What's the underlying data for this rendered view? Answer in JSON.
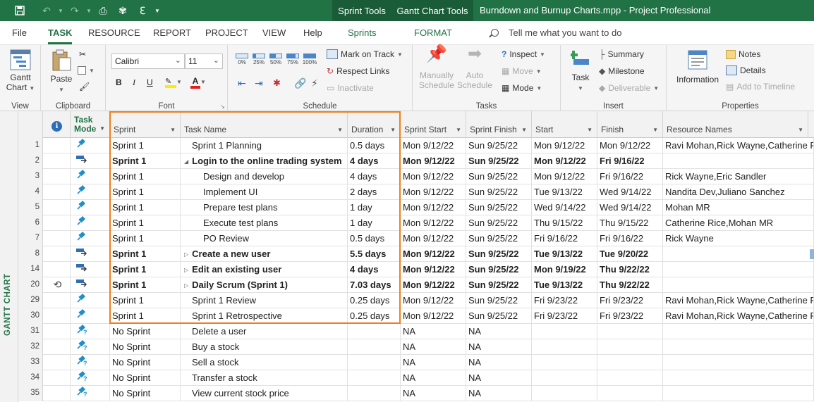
{
  "title_bar": {
    "context_tabs": [
      "Sprint Tools",
      "Gantt Chart Tools"
    ],
    "document_title": "Burndown and Burnup Charts.mpp  -  Project Professional"
  },
  "ribbon_tabs": [
    "File",
    "TASK",
    "RESOURCE",
    "REPORT",
    "PROJECT",
    "VIEW",
    "Help",
    "Sprints",
    "FORMAT"
  ],
  "tell_me": "Tell me what you want to do",
  "ribbon": {
    "view": {
      "gantt_chart": "Gantt\nChart",
      "label": "View"
    },
    "clipboard": {
      "paste": "Paste",
      "label": "Clipboard"
    },
    "font": {
      "family": "Calibri",
      "size": "11",
      "bold": "B",
      "italic": "I",
      "underline": "U",
      "label": "Font"
    },
    "schedule": {
      "mark_on_track": "Mark on Track",
      "respect_links": "Respect Links",
      "inactivate": "Inactivate",
      "label": "Schedule",
      "percents": [
        "0%",
        "25%",
        "50%",
        "75%",
        "100%"
      ]
    },
    "tasks": {
      "manually_schedule": "Manually\nSchedule",
      "auto_schedule": "Auto\nSchedule",
      "inspect": "Inspect",
      "move": "Move",
      "mode": "Mode",
      "label": "Tasks"
    },
    "insert": {
      "task": "Task",
      "summary": "Summary",
      "milestone": "Milestone",
      "deliverable": "Deliverable",
      "label": "Insert"
    },
    "properties": {
      "information": "Information",
      "notes": "Notes",
      "details": "Details",
      "add_to_timeline": "Add to Timeline",
      "label": "Properties"
    }
  },
  "view_label": "GANTT CHART",
  "columns": [
    "Task\nMode",
    "Sprint",
    "Task Name",
    "Duration",
    "Sprint Start",
    "Sprint Finish",
    "Start",
    "Finish",
    "Resource Names"
  ],
  "rows": [
    {
      "id": "1",
      "sprint": "Sprint 1",
      "name": "Sprint 1 Planning",
      "indent": 0,
      "summary": false,
      "dur": "0.5 days",
      "ss": "Mon 9/12/22",
      "sf": "Sun 9/25/22",
      "start": "Mon 9/12/22",
      "finish": "Mon 9/12/22",
      "res": "Ravi Mohan,Rick Wayne,Catherine Rice",
      "mode": "pin"
    },
    {
      "id": "2",
      "sprint": "Sprint 1",
      "name": "Login to the online trading system",
      "indent": 0,
      "summary": true,
      "expanded": true,
      "dur": "4 days",
      "ss": "Mon 9/12/22",
      "sf": "Sun 9/25/22",
      "start": "Mon 9/12/22",
      "finish": "Fri 9/16/22",
      "res": "",
      "mode": "auto"
    },
    {
      "id": "3",
      "sprint": "Sprint 1",
      "name": "Design and develop",
      "indent": 1,
      "summary": false,
      "dur": "4 days",
      "ss": "Mon 9/12/22",
      "sf": "Sun 9/25/22",
      "start": "Mon 9/12/22",
      "finish": "Fri 9/16/22",
      "res": "Rick Wayne,Eric Sandler",
      "mode": "pin"
    },
    {
      "id": "4",
      "sprint": "Sprint 1",
      "name": "Implement UI",
      "indent": 1,
      "summary": false,
      "dur": "2 days",
      "ss": "Mon 9/12/22",
      "sf": "Sun 9/25/22",
      "start": "Tue 9/13/22",
      "finish": "Wed 9/14/22",
      "res": "Nandita Dev,Juliano Sanchez",
      "mode": "pin"
    },
    {
      "id": "5",
      "sprint": "Sprint 1",
      "name": "Prepare test plans",
      "indent": 1,
      "summary": false,
      "dur": "1 day",
      "ss": "Mon 9/12/22",
      "sf": "Sun 9/25/22",
      "start": "Wed 9/14/22",
      "finish": "Wed 9/14/22",
      "res": "Mohan MR",
      "mode": "pin"
    },
    {
      "id": "6",
      "sprint": "Sprint 1",
      "name": "Execute test plans",
      "indent": 1,
      "summary": false,
      "dur": "1 day",
      "ss": "Mon 9/12/22",
      "sf": "Sun 9/25/22",
      "start": "Thu 9/15/22",
      "finish": "Thu 9/15/22",
      "res": "Catherine Rice,Mohan MR",
      "mode": "pin"
    },
    {
      "id": "7",
      "sprint": "Sprint 1",
      "name": "PO Review",
      "indent": 1,
      "summary": false,
      "dur": "0.5 days",
      "ss": "Mon 9/12/22",
      "sf": "Sun 9/25/22",
      "start": "Fri 9/16/22",
      "finish": "Fri 9/16/22",
      "res": "Rick Wayne",
      "mode": "pin"
    },
    {
      "id": "8",
      "sprint": "Sprint 1",
      "name": "Create a new user",
      "indent": 0,
      "summary": true,
      "expanded": false,
      "dur": "5.5 days",
      "ss": "Mon 9/12/22",
      "sf": "Sun 9/25/22",
      "start": "Tue 9/13/22",
      "finish": "Tue 9/20/22",
      "res": "",
      "mode": "auto"
    },
    {
      "id": "14",
      "sprint": "Sprint 1",
      "name": "Edit an existing user",
      "indent": 0,
      "summary": true,
      "expanded": false,
      "dur": "4 days",
      "ss": "Mon 9/12/22",
      "sf": "Sun 9/25/22",
      "start": "Mon 9/19/22",
      "finish": "Thu 9/22/22",
      "res": "",
      "mode": "auto"
    },
    {
      "id": "20",
      "sprint": "Sprint 1",
      "name": "Daily Scrum (Sprint 1)",
      "indent": 0,
      "summary": true,
      "expanded": false,
      "recurring": true,
      "dur": "7.03 days",
      "ss": "Mon 9/12/22",
      "sf": "Sun 9/25/22",
      "start": "Tue 9/13/22",
      "finish": "Thu 9/22/22",
      "res": "",
      "mode": "auto"
    },
    {
      "id": "29",
      "sprint": "Sprint 1",
      "name": "Sprint 1 Review",
      "indent": 0,
      "summary": false,
      "dur": "0.25 days",
      "ss": "Mon 9/12/22",
      "sf": "Sun 9/25/22",
      "start": "Fri 9/23/22",
      "finish": "Fri 9/23/22",
      "res": "Ravi Mohan,Rick Wayne,Catherine Rice",
      "mode": "pin"
    },
    {
      "id": "30",
      "sprint": "Sprint 1",
      "name": "Sprint 1 Retrospective",
      "indent": 0,
      "summary": false,
      "dur": "0.25 days",
      "ss": "Mon 9/12/22",
      "sf": "Sun 9/25/22",
      "start": "Fri 9/23/22",
      "finish": "Fri 9/23/22",
      "res": "Ravi Mohan,Rick Wayne,Catherine Rice",
      "mode": "pin"
    },
    {
      "id": "31",
      "sprint": "No Sprint",
      "name": "Delete a user",
      "indent": 0,
      "summary": false,
      "dur": "",
      "ss": "NA",
      "sf": "NA",
      "start": "",
      "finish": "",
      "res": "",
      "mode": "pinq"
    },
    {
      "id": "32",
      "sprint": "No Sprint",
      "name": "Buy a stock",
      "indent": 0,
      "summary": false,
      "dur": "",
      "ss": "NA",
      "sf": "NA",
      "start": "",
      "finish": "",
      "res": "",
      "mode": "pinq"
    },
    {
      "id": "33",
      "sprint": "No Sprint",
      "name": "Sell a stock",
      "indent": 0,
      "summary": false,
      "dur": "",
      "ss": "NA",
      "sf": "NA",
      "start": "",
      "finish": "",
      "res": "",
      "mode": "pinq"
    },
    {
      "id": "34",
      "sprint": "No Sprint",
      "name": "Transfer a stock",
      "indent": 0,
      "summary": false,
      "dur": "",
      "ss": "NA",
      "sf": "NA",
      "start": "",
      "finish": "",
      "res": "",
      "mode": "pinq"
    },
    {
      "id": "35",
      "sprint": "No Sprint",
      "name": "View current stock price",
      "indent": 0,
      "summary": false,
      "dur": "",
      "ss": "NA",
      "sf": "NA",
      "start": "",
      "finish": "",
      "res": "",
      "mode": "pinq"
    }
  ],
  "colors": {
    "brand": "#217346",
    "highlight": "#f07f1d",
    "pin": "#1e90c8"
  }
}
